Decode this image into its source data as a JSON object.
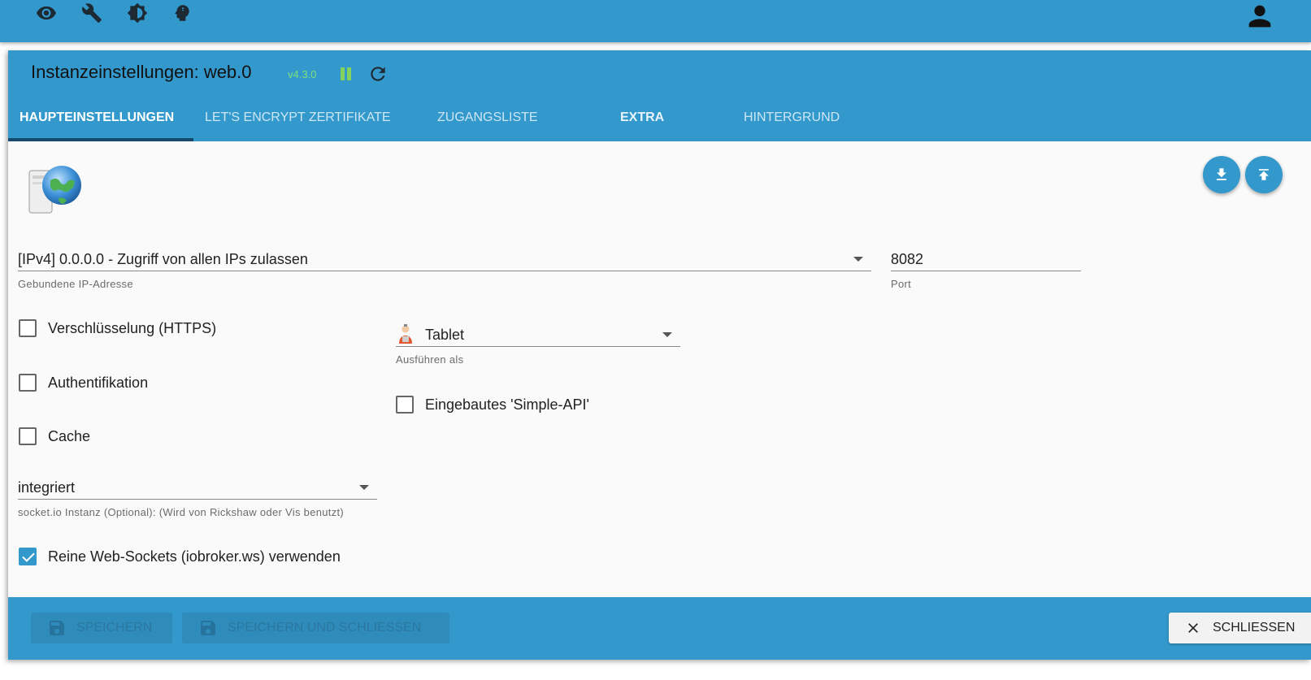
{
  "topbar": {
    "icons": [
      "eye-icon",
      "wrench-icon",
      "brightness-icon",
      "expert-mode-icon"
    ],
    "user_icon": "account-icon"
  },
  "dialog": {
    "title": "Instanzeinstellungen: web.0",
    "version": "v4.3.0",
    "tabs": [
      {
        "label": "HAUPTEINSTELLUNGEN",
        "active": true
      },
      {
        "label": "LET'S ENCRYPT ZERTIFIKATE",
        "active": false
      },
      {
        "label": "ZUGANGSLISTE",
        "active": false
      },
      {
        "label": "EXTRA",
        "active": false
      },
      {
        "label": "HINTERGRUND",
        "active": false
      }
    ]
  },
  "form": {
    "bind_ip": {
      "value": "[IPv4] 0.0.0.0 - Zugriff von allen IPs zulassen",
      "helper": "Gebundene IP-Adresse"
    },
    "port": {
      "value": "8082",
      "helper": "Port"
    },
    "https": {
      "label": "Verschlüsselung (HTTPS)",
      "checked": false
    },
    "auth": {
      "label": "Authentifikation",
      "checked": false
    },
    "cache": {
      "label": "Cache",
      "checked": false
    },
    "run_as": {
      "value": "Tablet",
      "helper": "Ausführen als"
    },
    "simple_api": {
      "label": "Eingebautes 'Simple-API'",
      "checked": false
    },
    "socketio": {
      "value": "integriert",
      "helper": "socket.io Instanz (Optional): (Wird von Rickshaw oder Vis benutzt)"
    },
    "pure_ws": {
      "label": "Reine Web-Sockets (iobroker.ws) verwenden",
      "checked": true
    }
  },
  "footer": {
    "save_label": "SPEICHERN",
    "save_close_label": "SPEICHERN UND SCHLIESSEN",
    "close_label": "SCHLIESSEN"
  },
  "colors": {
    "primary": "#3399cc",
    "version": "#7ee07e",
    "pause": "#84d15b"
  }
}
